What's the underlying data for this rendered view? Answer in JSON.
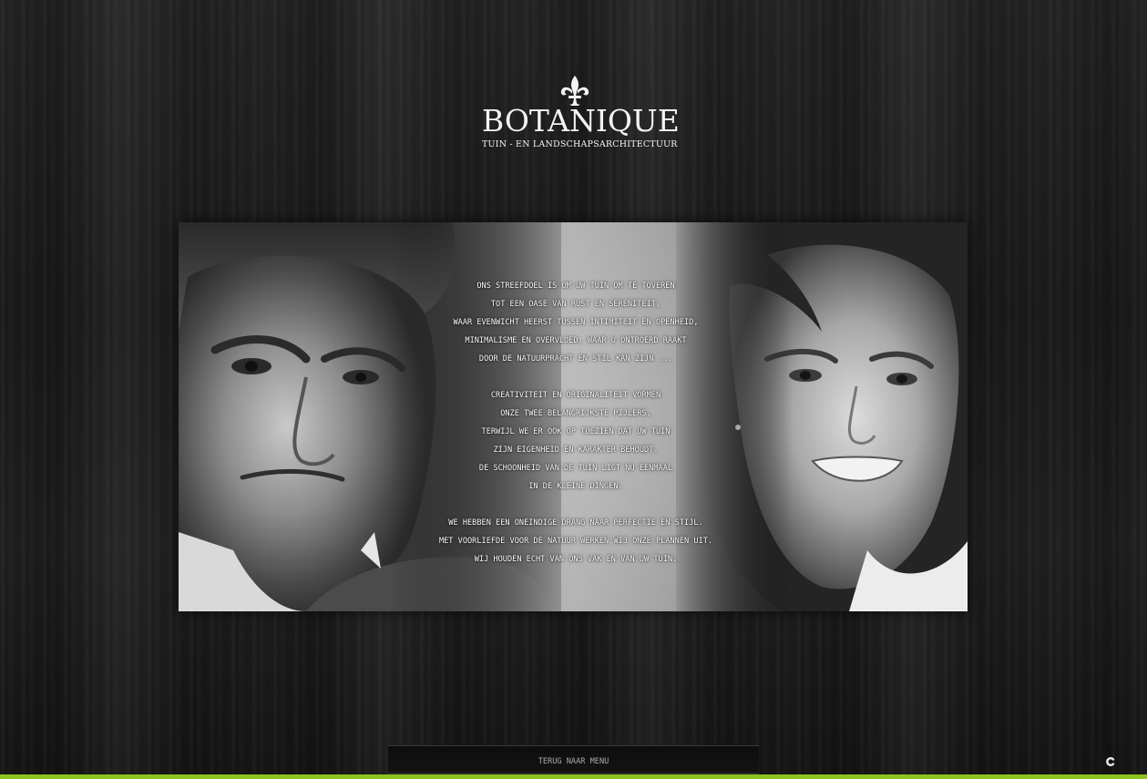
{
  "logo": {
    "icon": "fleur-de-lis-icon",
    "brand": "BOTANIQUE",
    "tagline": "TUIN - EN LANDSCHAPSARCHITECTUUR"
  },
  "mission": {
    "paragraphs": [
      [
        "ONS STREEFDOEL IS OM UW TUIN OM TE TOVEREN",
        "TOT EEN OASE VAN RUST EN SERENITEIT,",
        "WAAR EVENWICHT HEERST TUSSEN INTIMITEIT EN OPENHEID,",
        "MINIMALISME EN OVERVLOED, WAAR U ONTROERD RAAKT",
        "DOOR DE NATUURPRACHT EN STIL KAN ZIJN ..."
      ],
      [
        "CREATIVITEIT EN ORIGINALITEIT VORMEN",
        "ONZE TWEE BELANGRIJKSTE PIJLERS,",
        "TERWIJL WE ER OOK OP TOEZIEN DAT UW TUIN",
        "ZIJN EIGENHEID EN KARAKTER BEHOUDT.",
        "DE SCHOONHEID VAN DE TUIN LIGT NU EENMAAL",
        "IN DE KLEINE DINGEN."
      ],
      [
        "WE HEBBEN EEN ONEINDIGE DRANG NAAR PERFECTIE EN STIJL.",
        "MET VOORLIEFDE VOOR DE NATUUR WERKEN WIJ ONZE PLANNEN UIT.",
        "WIJ HOUDEN ECHT VAN ONS VAK EN VAN UW TUIN."
      ]
    ]
  },
  "nav": {
    "back_label": "TERUG NAAR MENU"
  },
  "footer": {
    "credit_icon": "c-logo-icon"
  },
  "colors": {
    "accent": "#8dc21f",
    "background": "#1d1d1d",
    "text": "#ffffff",
    "button_text": "#a9a9a9"
  }
}
